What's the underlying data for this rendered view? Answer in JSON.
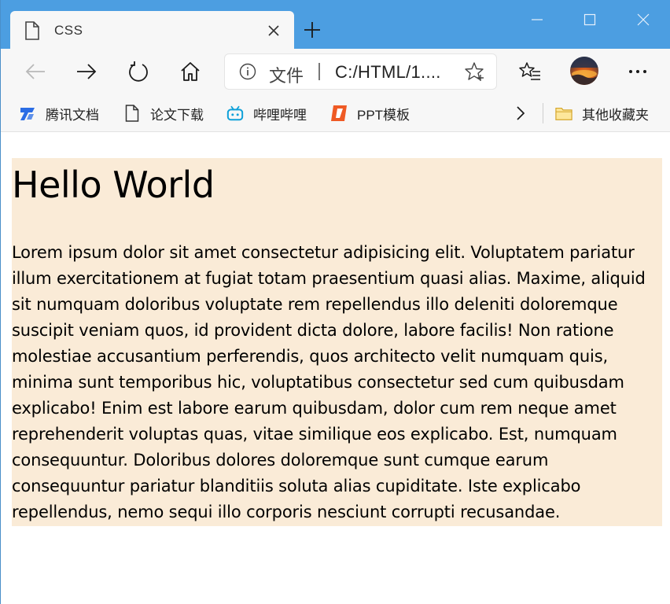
{
  "tab": {
    "title": "CSS"
  },
  "addressbar": {
    "security_label": "文件",
    "url": "C:/HTML/1...."
  },
  "bookmarks": {
    "items": [
      {
        "label": "腾讯文档",
        "icon": "tencent-docs-icon"
      },
      {
        "label": "论文下载",
        "icon": "page-icon"
      },
      {
        "label": "哔哩哔哩",
        "icon": "bilibili-icon"
      },
      {
        "label": "PPT模板",
        "icon": "ppt-icon"
      }
    ],
    "other_favorites": "其他收藏夹"
  },
  "page": {
    "heading": "Hello World",
    "paragraph": "Lorem ipsum dolor sit amet consectetur adipisicing elit. Voluptatem pariatur illum exercitationem at fugiat totam praesentium quasi alias. Maxime, aliquid sit numquam doloribus voluptate rem repellendus illo deleniti doloremque suscipit veniam quos, id provident dicta dolore, labore facilis! Non ratione molestiae accusantium perferendis, quos architecto velit numquam quis, minima sunt temporibus hic, voluptatibus consectetur sed cum quibusdam explicabo! Enim est labore earum quibusdam, dolor cum rem neque amet reprehenderit voluptas quas, vitae similique eos explicabo. Est, numquam consequuntur. Doloribus dolores doloremque sunt cumque earum consequuntur pariatur blanditiis soluta alias cupiditate. Iste explicabo repellendus, nemo sequi illo corporis nesciunt corrupti recusandae."
  },
  "colors": {
    "titlebar": "#4c9ee1",
    "toolbar": "#f7f7f7",
    "content_box": "#faebd7"
  }
}
